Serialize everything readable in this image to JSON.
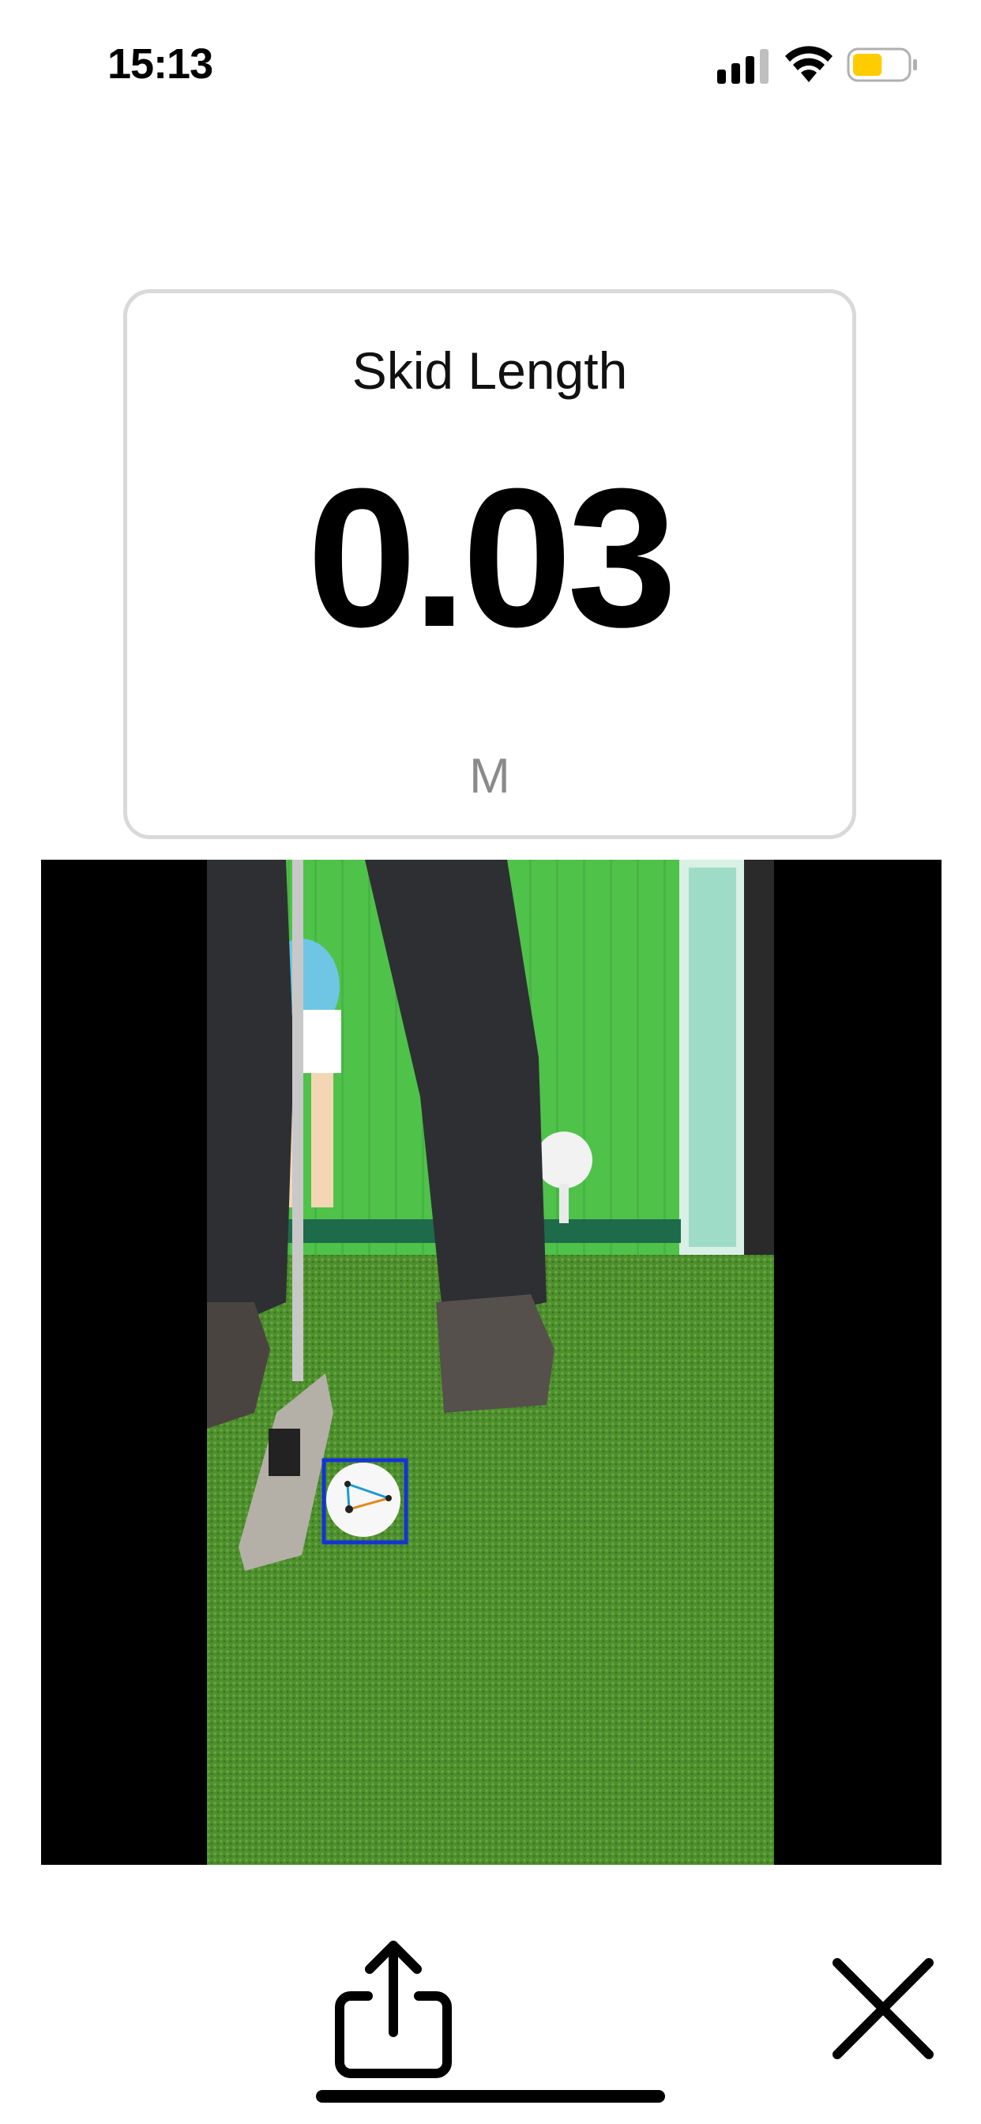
{
  "status_bar": {
    "time": "15:13",
    "battery_level": 0.55,
    "battery_color": "#FFCC00"
  },
  "metric": {
    "title": "Skid Length",
    "value": "0.03",
    "unit": "M"
  },
  "video": {
    "background_color": "#000000",
    "turf_color": "#4a8a2a",
    "wall_color": "#4fc24a",
    "tracking_box_color": "#1533d6"
  },
  "actions": {
    "share_icon": "share-icon",
    "close_icon": "close-icon"
  }
}
